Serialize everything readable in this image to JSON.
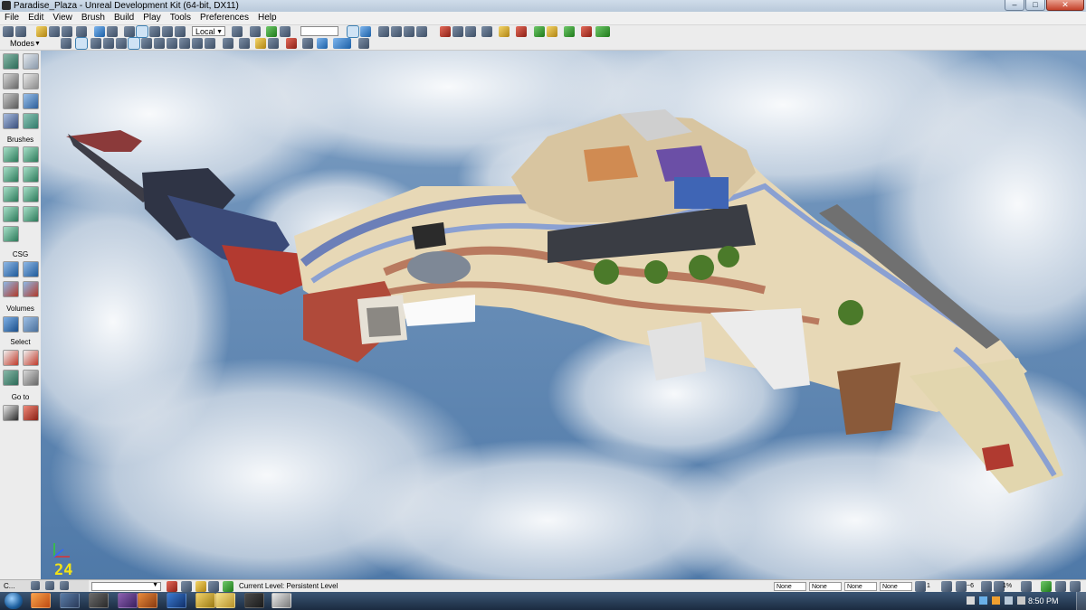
{
  "window": {
    "title": "Paradise_Plaza - Unreal Development Kit (64-bit, DX11)",
    "minimize_label": "–",
    "maximize_label": "□",
    "close_label": "✕"
  },
  "menu": [
    "File",
    "Edit",
    "View",
    "Brush",
    "Build",
    "Play",
    "Tools",
    "Preferences",
    "Help"
  ],
  "toolbar": {
    "coordinate_space": "Local"
  },
  "modes_bar": {
    "label": "Modes"
  },
  "left_panel": {
    "sections": [
      "Brushes",
      "CSG",
      "Volumes",
      "Select",
      "Go to"
    ]
  },
  "viewport": {
    "fps": "24",
    "sky_color": "#5f86b0",
    "cloud_color": "#e9edf1"
  },
  "status_bar": {
    "command_label": "C...",
    "current_level": "Current Level:  Persistent Level",
    "snap_fields": [
      "None",
      "None",
      "None",
      "None"
    ],
    "grid_value": "1",
    "rotation_value": "~6",
    "scale_value": "1%"
  },
  "taskbar": {
    "clock": "8:50 PM"
  },
  "colors": {
    "menu_bg": "#f0f0f0",
    "panel_bg": "#ececec",
    "taskbar": "#1b2b40",
    "fps_text": "#f3e316"
  }
}
